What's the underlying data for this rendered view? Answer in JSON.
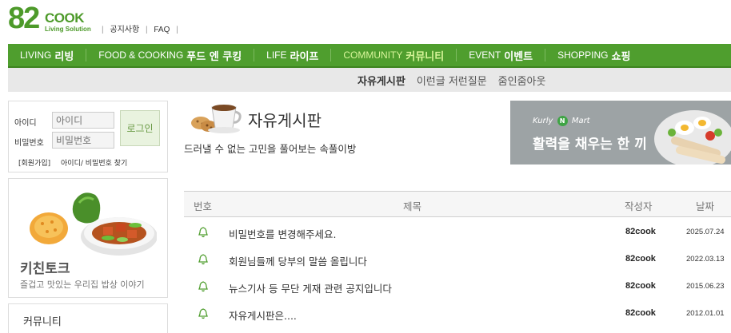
{
  "header": {
    "logo_number": "82",
    "logo_word": "COOK",
    "logo_tagline": "Living Solution",
    "links": [
      "공지사항",
      "FAQ"
    ],
    "brand_color": "#4d9a2a"
  },
  "gnb": [
    {
      "en": "LIVING",
      "ko": "리빙"
    },
    {
      "en": "FOOD & COOKING",
      "ko": "푸드 엔 쿠킹"
    },
    {
      "en": "LIFE",
      "ko": "라이프"
    },
    {
      "en": "COMMUNITY",
      "ko": "커뮤니티"
    },
    {
      "en": "EVENT",
      "ko": "이벤트"
    },
    {
      "en": "SHOPPING",
      "ko": "쇼핑"
    }
  ],
  "subnav": [
    "자유게시판",
    "이런글 저런질문",
    "줌인줌아웃"
  ],
  "login": {
    "id_label": "아이디",
    "id_placeholder": "아이디",
    "pw_label": "비밀번호",
    "pw_placeholder": "비밀번호",
    "login_button": "로그인",
    "join_link": "[회원가입]",
    "find_link": "아이디/ 비밀번호 찾기"
  },
  "kitchen": {
    "title": "키친토크",
    "subtitle": "즐겁고 맛있는 우리집 밥상 이야기"
  },
  "community": {
    "title": "커뮤니티"
  },
  "board": {
    "title": "자유게시판",
    "description": "드러낼 수 없는 고민을 풀어보는 속풀이방"
  },
  "banner": {
    "logo_left": "Kurly",
    "logo_mid": "N",
    "logo_right": "Mart",
    "copy": "활력을 채우는 한 끼"
  },
  "table": {
    "headers": {
      "num": "번호",
      "title": "제목",
      "author": "작성자",
      "date": "날짜"
    },
    "rows": [
      {
        "title": "비밀번호를 변경해주세요.",
        "author": "82cook",
        "date": "2025.07.24"
      },
      {
        "title": "회원님들께 당부의 말씀 올립니다",
        "author": "82cook",
        "date": "2022.03.13"
      },
      {
        "title": "뉴스기사 등 무단 게재 관련 공지입니다",
        "author": "82cook",
        "date": "2015.06.23"
      },
      {
        "title": "자유게시판은....",
        "author": "82cook",
        "date": "2012.01.01"
      }
    ]
  }
}
